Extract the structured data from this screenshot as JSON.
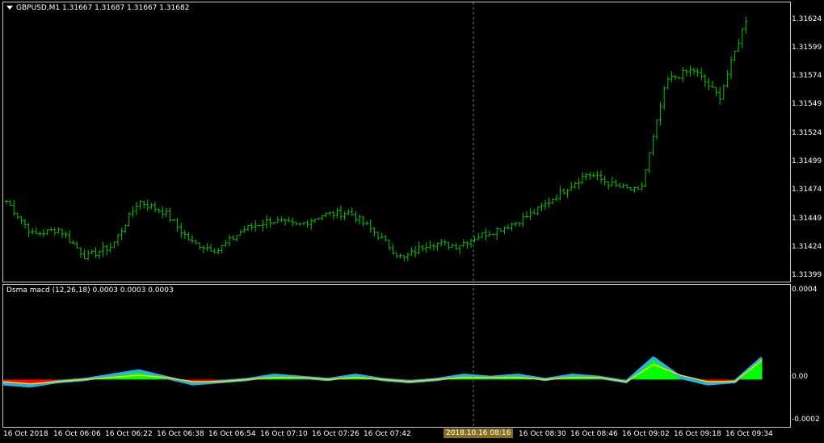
{
  "main_chart": {
    "symbol_line": "GBPUSD,M1  1.31667 1.31687 1.31667 1.31682",
    "price_labels": [
      "1.31624",
      "1.31599",
      "1.31574",
      "1.31549",
      "1.31524",
      "1.31499",
      "1.31474",
      "1.31449",
      "1.31424",
      "1.31399"
    ],
    "bar_color": "#00c800"
  },
  "indicator": {
    "title_line": "Dsma macd (12,26,18) 0.0003 0.0003 0.0003",
    "scale_labels": [
      "0.0004",
      "0.00",
      "-0.0002"
    ],
    "colors": {
      "positive": "#00ff00",
      "negative": "#ff0000",
      "macd": "#1eb4e6",
      "signal": "#ffd700"
    }
  },
  "time_axis": {
    "labels": [
      "16 Oct 2018",
      "16 Oct 06:06",
      "16 Oct 06:22",
      "16 Oct 06:38",
      "16 Oct 06:54",
      "16 Oct 07:10",
      "16 Oct 07:26",
      "16 Oct 07:42",
      "16 Oct 08:30",
      "16 Oct 08:46",
      "16 Oct 09:02",
      "16 Oct 09:18",
      "16 Oct 09:34"
    ],
    "cursor_time": "2018.10.16 08:16"
  },
  "chart_data": {
    "type": "line",
    "title": "GBPUSD,M1",
    "x": [
      "06:00",
      "06:06",
      "06:14",
      "06:22",
      "06:30",
      "06:38",
      "06:46",
      "06:54",
      "07:02",
      "07:10",
      "07:18",
      "07:26",
      "07:34",
      "07:42",
      "07:50",
      "07:58",
      "08:06",
      "08:14",
      "08:22",
      "08:30",
      "08:38",
      "08:46",
      "08:54",
      "09:02",
      "09:10",
      "09:18",
      "09:26",
      "09:34",
      "09:38"
    ],
    "series": [
      {
        "name": "GBPUSD,M1",
        "values": [
          1.31462,
          1.31432,
          1.31437,
          1.31412,
          1.31422,
          1.31462,
          1.31452,
          1.31425,
          1.31418,
          1.31437,
          1.31445,
          1.3144,
          1.3145,
          1.31452,
          1.31433,
          1.3141,
          1.31425,
          1.31422,
          1.31432,
          1.3144,
          1.31452,
          1.3147,
          1.31487,
          1.31476,
          1.3147,
          1.3157,
          1.3158,
          1.31555,
          1.31625
        ]
      }
    ],
    "ylim": [
      1.3139,
      1.3164
    ],
    "indicator_series": [
      {
        "name": "macd",
        "values": [
          -2e-05,
          -3e-05,
          -1e-05,
          0.0,
          2e-05,
          4e-05,
          1e-05,
          -2e-05,
          -1e-05,
          0.0,
          2e-05,
          1e-05,
          0.0,
          2e-05,
          0.0,
          -1e-05,
          0.0,
          2e-05,
          1e-05,
          2e-05,
          0.0,
          2e-05,
          1e-05,
          -1e-05,
          0.0001,
          1e-05,
          -2e-05,
          -1e-05,
          0.0001
        ]
      },
      {
        "name": "signal",
        "values": [
          -1e-05,
          -2e-05,
          -1e-05,
          0.0,
          1e-05,
          2e-05,
          1e-05,
          -1e-05,
          -1e-05,
          0.0,
          1e-05,
          1e-05,
          0.0,
          1e-05,
          0.0,
          -1e-05,
          0.0,
          1e-05,
          1e-05,
          1e-05,
          0.0,
          1e-05,
          1e-05,
          -1e-05,
          7e-05,
          2e-05,
          -1e-05,
          -1e-05,
          9e-05
        ]
      }
    ],
    "indicator_ylim": [
      -0.00022,
      0.00044
    ]
  }
}
